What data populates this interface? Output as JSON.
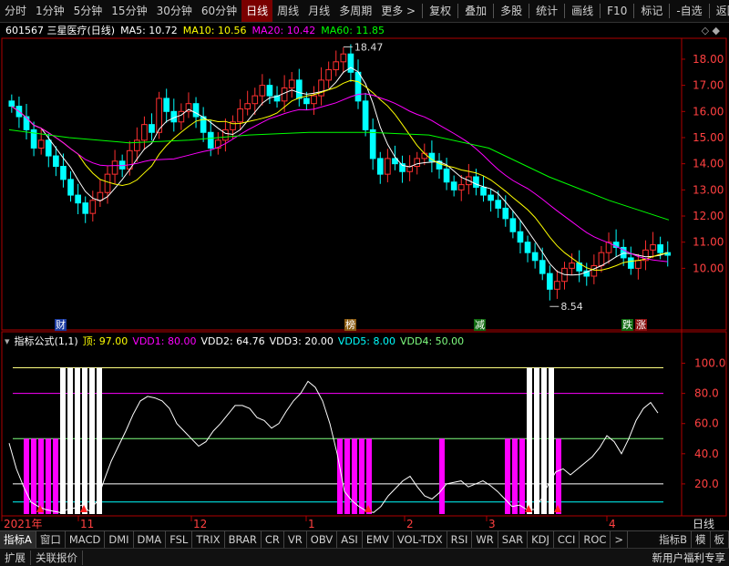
{
  "toolbar": {
    "periods": [
      "分时",
      "1分钟",
      "5分钟",
      "15分钟",
      "30分钟",
      "60分钟",
      "日线",
      "周线",
      "月线",
      "多周期",
      "更多 >"
    ],
    "active_period": "日线",
    "right_items": [
      "复权",
      "叠加",
      "多股",
      "统计",
      "画线",
      "F10",
      "标记",
      "-自选",
      "返回"
    ]
  },
  "main_info": {
    "stock": "601567 三星医疗(日线)",
    "ma5": "MA5: 10.72",
    "ma10": "MA10: 10.56",
    "ma20": "MA20: 10.42",
    "ma60": "MA60: 11.85",
    "icon_right": "◇ ◆"
  },
  "sub_info": {
    "name": "指标公式(1,1)",
    "top": "顶: 97.00",
    "vdd1": "VDD1: 80.00",
    "vdd2": "VDD2: 64.76",
    "vdd3": "VDD3: 20.00",
    "vdd5": "VDD5: 8.00",
    "vdd4": "VDD4: 50.00"
  },
  "colors": {
    "candle_up": "#ff3030",
    "candle_down": "#00ffff",
    "ma5": "#ffffff",
    "ma10": "#ffff00",
    "ma20": "#ff00ff",
    "ma60": "#00ff00",
    "frame": "#b00000"
  },
  "markers": {
    "cai": "财",
    "bang": "榜",
    "jian": "减",
    "die": "跌",
    "zhang": "涨"
  },
  "annotations": {
    "high": "18.47",
    "low": "8.54"
  },
  "dates": [
    "2021年",
    "11",
    "12",
    "1",
    "2",
    "3",
    "4"
  ],
  "period_label": "日线",
  "bottom_tabs": [
    "指标A",
    "窗口",
    "MACD",
    "DMI",
    "DMA",
    "FSL",
    "TRIX",
    "BRAR",
    "CR",
    "VR",
    "OBV",
    "ASI",
    "EMV",
    "VOL-TDX",
    "RSI",
    "WR",
    "SAR",
    "KDJ",
    "CCI",
    "ROC",
    ">",
    "指标B",
    "模",
    "板"
  ],
  "status": {
    "left": [
      "扩展",
      "关联报价"
    ],
    "right": "新用户福利专享"
  },
  "chart_data": [
    {
      "type": "candlestick",
      "ylim": [
        8.2,
        18.8
      ],
      "y_ticks": [
        10.0,
        11.0,
        12.0,
        13.0,
        14.0,
        15.0,
        16.0,
        17.0,
        18.0
      ],
      "high": 18.47,
      "low": 8.54,
      "close": [
        16.2,
        15.8,
        15.3,
        14.6,
        14.9,
        14.3,
        13.9,
        13.4,
        12.8,
        12.5,
        12.1,
        12.6,
        12.9,
        13.6,
        14.1,
        13.8,
        14.5,
        14.9,
        15.5,
        15.2,
        16.5,
        16.0,
        15.6,
        16.0,
        16.3,
        15.8,
        15.2,
        14.6,
        14.9,
        15.3,
        15.6,
        16.1,
        16.3,
        16.6,
        17.0,
        16.6,
        16.4,
        16.9,
        17.2,
        16.5,
        16.3,
        16.6,
        17.2,
        17.6,
        17.9,
        18.2,
        17.5,
        16.4,
        15.3,
        14.2,
        13.6,
        14.2,
        14.0,
        13.7,
        13.9,
        14.2,
        14.4,
        14.1,
        13.8,
        13.3,
        13.0,
        13.2,
        13.5,
        13.1,
        12.8,
        12.6,
        12.3,
        11.9,
        11.4,
        11.0,
        10.6,
        10.3,
        9.8,
        9.2,
        9.5,
        10.0,
        10.2,
        9.9,
        9.7,
        10.1,
        10.6,
        11.0,
        10.8,
        10.4,
        10.0,
        10.3,
        10.7,
        10.9,
        10.6,
        10.5
      ],
      "ma60_values": [
        15.3,
        15.0,
        14.8,
        14.9,
        15.1,
        15.2,
        15.2,
        15.1,
        14.6,
        13.5,
        12.6,
        11.85
      ]
    },
    {
      "type": "line",
      "ylim": [
        0,
        110
      ],
      "y_ticks": [
        20.0,
        40.0,
        60.0,
        80.0,
        100.0
      ],
      "h_lines": [
        97,
        80,
        50,
        20,
        8
      ],
      "values": [
        47,
        30,
        18,
        8,
        5,
        3,
        2,
        1,
        3,
        4,
        6,
        2,
        8,
        22,
        35,
        45,
        55,
        66,
        75,
        78,
        77,
        75,
        70,
        60,
        55,
        50,
        45,
        48,
        55,
        60,
        66,
        72,
        72,
        70,
        64,
        62,
        57,
        60,
        68,
        75,
        80,
        88,
        84,
        75,
        60,
        40,
        15,
        9,
        5,
        2,
        1,
        5,
        12,
        17,
        22,
        25,
        18,
        12,
        10,
        14,
        20,
        21,
        22,
        18,
        20,
        22,
        19,
        15,
        10,
        5,
        6,
        3,
        3,
        10,
        20,
        28,
        30,
        26,
        30,
        34,
        38,
        44,
        52,
        48,
        40,
        50,
        62,
        70,
        74,
        67
      ],
      "column_bars": [
        {
          "x_range": [
            2,
            12
          ],
          "value": 50,
          "color": "#ff00ff"
        },
        {
          "x_range": [
            7,
            12
          ],
          "value": 97,
          "color": "#ffffff"
        },
        {
          "x_range": [
            45,
            49
          ],
          "value": 50,
          "color": "#ff00ff"
        },
        {
          "x_range": [
            59,
            59
          ],
          "value": 50,
          "color": "#ff00ff"
        },
        {
          "x_range": [
            68,
            75
          ],
          "value": 50,
          "color": "#ff00ff"
        },
        {
          "x_range": [
            71,
            74
          ],
          "value": 97,
          "color": "#ffffff"
        }
      ]
    }
  ]
}
